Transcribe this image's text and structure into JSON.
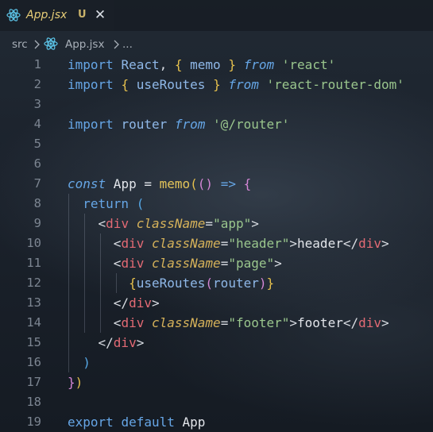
{
  "tab": {
    "title": "App.jsx",
    "status": "U",
    "close_glyph": "✕",
    "icon": "react-icon"
  },
  "breadcrumb": {
    "folder": "src",
    "file": "App.jsx",
    "more": "...",
    "separator_icon": "chevron-right-icon",
    "file_icon": "react-icon"
  },
  "colors": {
    "keyword": "#66a6e6",
    "string": "#9ac68d",
    "function": "#e4c55a",
    "tag": "#e26a74",
    "attribute": "#d6b25a",
    "tab_title": "#e6cc77"
  },
  "code": {
    "lines": [
      {
        "n": "1",
        "tokens": [
          {
            "t": "import",
            "c": "kw"
          },
          {
            "t": " ",
            "c": "txt"
          },
          {
            "t": "React",
            "c": "ident"
          },
          {
            "t": ", ",
            "c": "pun"
          },
          {
            "t": "{",
            "c": "br1"
          },
          {
            "t": " ",
            "c": "txt"
          },
          {
            "t": "memo",
            "c": "ident"
          },
          {
            "t": " ",
            "c": "txt"
          },
          {
            "t": "}",
            "c": "br1"
          },
          {
            "t": " ",
            "c": "txt"
          },
          {
            "t": "from",
            "c": "kwi"
          },
          {
            "t": " ",
            "c": "txt"
          },
          {
            "t": "'react'",
            "c": "str"
          }
        ]
      },
      {
        "n": "2",
        "tokens": [
          {
            "t": "import",
            "c": "kw"
          },
          {
            "t": " ",
            "c": "txt"
          },
          {
            "t": "{",
            "c": "br1"
          },
          {
            "t": " ",
            "c": "txt"
          },
          {
            "t": "useRoutes",
            "c": "ident"
          },
          {
            "t": " ",
            "c": "txt"
          },
          {
            "t": "}",
            "c": "br1"
          },
          {
            "t": " ",
            "c": "txt"
          },
          {
            "t": "from",
            "c": "kwi"
          },
          {
            "t": " ",
            "c": "txt"
          },
          {
            "t": "'react-router-dom'",
            "c": "str"
          }
        ]
      },
      {
        "n": "3",
        "tokens": []
      },
      {
        "n": "4",
        "tokens": [
          {
            "t": "import",
            "c": "kw"
          },
          {
            "t": " ",
            "c": "txt"
          },
          {
            "t": "router",
            "c": "ident"
          },
          {
            "t": " ",
            "c": "txt"
          },
          {
            "t": "from",
            "c": "kwi"
          },
          {
            "t": " ",
            "c": "txt"
          },
          {
            "t": "'@/router'",
            "c": "str"
          }
        ]
      },
      {
        "n": "5",
        "tokens": []
      },
      {
        "n": "6",
        "tokens": []
      },
      {
        "n": "7",
        "tokens": [
          {
            "t": "const",
            "c": "kwi"
          },
          {
            "t": " App = ",
            "c": "txt"
          },
          {
            "t": "memo",
            "c": "fn"
          },
          {
            "t": "(",
            "c": "br1"
          },
          {
            "t": "()",
            "c": "br2"
          },
          {
            "t": " ",
            "c": "txt"
          },
          {
            "t": "=>",
            "c": "kw"
          },
          {
            "t": " ",
            "c": "txt"
          },
          {
            "t": "{",
            "c": "br2"
          }
        ]
      },
      {
        "n": "8",
        "tokens": [
          {
            "t": "  ",
            "c": "txt"
          },
          {
            "t": "return",
            "c": "kw"
          },
          {
            "t": " ",
            "c": "txt"
          },
          {
            "t": "(",
            "c": "br3"
          }
        ]
      },
      {
        "n": "9",
        "tokens": [
          {
            "t": "    ",
            "c": "txt"
          },
          {
            "t": "<",
            "c": "pun"
          },
          {
            "t": "div",
            "c": "tag"
          },
          {
            "t": " ",
            "c": "txt"
          },
          {
            "t": "className",
            "c": "attr"
          },
          {
            "t": "=",
            "c": "pun"
          },
          {
            "t": "\"app\"",
            "c": "str"
          },
          {
            "t": ">",
            "c": "pun"
          }
        ]
      },
      {
        "n": "10",
        "tokens": [
          {
            "t": "      ",
            "c": "txt"
          },
          {
            "t": "<",
            "c": "pun"
          },
          {
            "t": "div",
            "c": "tag"
          },
          {
            "t": " ",
            "c": "txt"
          },
          {
            "t": "className",
            "c": "attr"
          },
          {
            "t": "=",
            "c": "pun"
          },
          {
            "t": "\"header\"",
            "c": "str"
          },
          {
            "t": ">",
            "c": "pun"
          },
          {
            "t": "header",
            "c": "txt"
          },
          {
            "t": "</",
            "c": "pun"
          },
          {
            "t": "div",
            "c": "tag"
          },
          {
            "t": ">",
            "c": "pun"
          }
        ]
      },
      {
        "n": "11",
        "tokens": [
          {
            "t": "      ",
            "c": "txt"
          },
          {
            "t": "<",
            "c": "pun"
          },
          {
            "t": "div",
            "c": "tag"
          },
          {
            "t": " ",
            "c": "txt"
          },
          {
            "t": "className",
            "c": "attr"
          },
          {
            "t": "=",
            "c": "pun"
          },
          {
            "t": "\"page\"",
            "c": "str"
          },
          {
            "t": ">",
            "c": "pun"
          }
        ]
      },
      {
        "n": "12",
        "tokens": [
          {
            "t": "        ",
            "c": "txt"
          },
          {
            "t": "{",
            "c": "br1"
          },
          {
            "t": "useRoutes",
            "c": "ident"
          },
          {
            "t": "(",
            "c": "br2"
          },
          {
            "t": "router",
            "c": "ident"
          },
          {
            "t": ")",
            "c": "br2"
          },
          {
            "t": "}",
            "c": "br1"
          }
        ]
      },
      {
        "n": "13",
        "tokens": [
          {
            "t": "      ",
            "c": "txt"
          },
          {
            "t": "</",
            "c": "pun"
          },
          {
            "t": "div",
            "c": "tag"
          },
          {
            "t": ">",
            "c": "pun"
          }
        ]
      },
      {
        "n": "14",
        "tokens": [
          {
            "t": "      ",
            "c": "txt"
          },
          {
            "t": "<",
            "c": "pun"
          },
          {
            "t": "div",
            "c": "tag"
          },
          {
            "t": " ",
            "c": "txt"
          },
          {
            "t": "className",
            "c": "attr"
          },
          {
            "t": "=",
            "c": "pun"
          },
          {
            "t": "\"footer\"",
            "c": "str"
          },
          {
            "t": ">",
            "c": "pun"
          },
          {
            "t": "footer",
            "c": "txt"
          },
          {
            "t": "</",
            "c": "pun"
          },
          {
            "t": "div",
            "c": "tag"
          },
          {
            "t": ">",
            "c": "pun"
          }
        ]
      },
      {
        "n": "15",
        "tokens": [
          {
            "t": "    ",
            "c": "txt"
          },
          {
            "t": "</",
            "c": "pun"
          },
          {
            "t": "div",
            "c": "tag"
          },
          {
            "t": ">",
            "c": "pun"
          }
        ]
      },
      {
        "n": "16",
        "tokens": [
          {
            "t": "  ",
            "c": "txt"
          },
          {
            "t": ")",
            "c": "br3"
          }
        ]
      },
      {
        "n": "17",
        "tokens": [
          {
            "t": "}",
            "c": "br2"
          },
          {
            "t": ")",
            "c": "br1"
          }
        ]
      },
      {
        "n": "18",
        "tokens": []
      },
      {
        "n": "19",
        "tokens": [
          {
            "t": "export",
            "c": "kw"
          },
          {
            "t": " ",
            "c": "txt"
          },
          {
            "t": "default",
            "c": "kw"
          },
          {
            "t": " App",
            "c": "txt"
          }
        ]
      }
    ]
  }
}
